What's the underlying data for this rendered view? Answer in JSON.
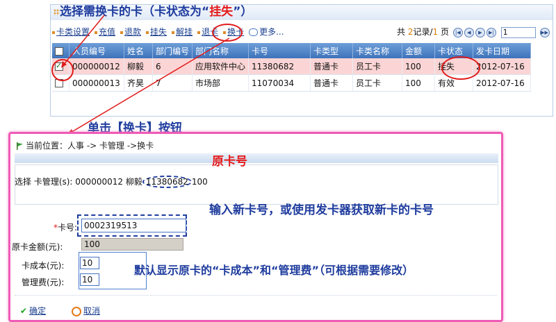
{
  "top_annotation": {
    "prefix": "选择需换卡的卡（卡状态为“",
    "highlight": "挂失",
    "suffix": "”）"
  },
  "toolbar": {
    "items": [
      "卡类设置",
      "充值",
      "退款",
      "挂失",
      "解挂",
      "退卡",
      "换卡"
    ],
    "more": "更多..."
  },
  "pager": {
    "prefix": "共",
    "pages": "2",
    "mid": "记录/",
    "current": "1",
    "suffix": "页",
    "page_value": "1"
  },
  "table": {
    "headers": [
      "人员编号",
      "姓名",
      "部门编号",
      "部门名称",
      "卡号",
      "卡类型",
      "卡类名称",
      "金额",
      "卡状态",
      "发卡日期"
    ],
    "rows": [
      {
        "checked": true,
        "cells": [
          "000000012",
          "柳毅",
          "6",
          "应用软件中心",
          "11380682",
          "普通卡",
          "员工卡",
          "100",
          "挂失",
          "2012-07-16"
        ]
      },
      {
        "checked": false,
        "cells": [
          "000000013",
          "齐昊",
          "7",
          "市场部",
          "11070034",
          "普通卡",
          "员工卡",
          "100",
          "有效",
          "2012-07-16"
        ]
      }
    ]
  },
  "click_annotation": "单击【换卡】按钮",
  "breadcrumb": "当前位置：人事 -> 卡管理 ->换卡",
  "orig_annotation": "原卡号",
  "info": {
    "prefix": "选择 卡管理(s): 000000012 柳毅",
    "card": "11380682",
    "suffix": "100"
  },
  "input_annotation": "输入新卡号，或使用发卡器获取新卡的卡号",
  "form": {
    "card_star": "*",
    "card_label": "卡号:",
    "card_value": "0002319513",
    "balance_label": "原卡金额(元):",
    "balance_value": "100",
    "cost_label": "卡成本(元):",
    "cost_value": "10",
    "fee_label": "管理费(元):",
    "fee_value": "10"
  },
  "default_annotation": "默认显示原卡的“卡成本”和“管理费”（可根据需要修改）",
  "buttons": {
    "ok": "确定",
    "cancel": "取消"
  },
  "colors": {
    "annotation_blue": "#1f3c9e",
    "annotation_red": "#e41b1b",
    "highlight_row": "#fbd5d5",
    "panel_border": "#ef5bb6"
  }
}
